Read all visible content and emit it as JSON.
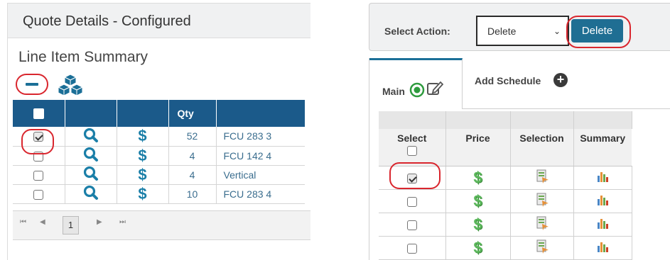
{
  "left": {
    "header_title": "Quote Details - Configured",
    "section_title": "Line Item Summary",
    "grid": {
      "headers": [
        "",
        "",
        "",
        "Qty",
        ""
      ],
      "rows": [
        {
          "checked": true,
          "qty": "52",
          "item": "FCU 283 3"
        },
        {
          "checked": false,
          "qty": "4",
          "item": "FCU 142 4"
        },
        {
          "checked": false,
          "qty": "4",
          "item": "Vertical"
        },
        {
          "checked": false,
          "qty": "10",
          "item": "FCU 283 4"
        }
      ]
    },
    "pager": {
      "first": "⏮",
      "prev": "◀",
      "page": "1",
      "next": "▶",
      "last": "⏭"
    }
  },
  "right": {
    "action_label": "Select Action:",
    "action_selected": "Delete",
    "delete_button": "Delete",
    "tabs": {
      "main": "Main",
      "add_schedule": "Add Schedule"
    },
    "grid": {
      "headers": [
        "Select",
        "Price",
        "Selection",
        "Summary"
      ],
      "rows": [
        {
          "checked": true
        },
        {
          "checked": false
        },
        {
          "checked": false
        },
        {
          "checked": false
        }
      ]
    }
  },
  "colors": {
    "header_blue": "#1b5a8a",
    "accent_blue": "#1b6f97",
    "highlight_red": "#d9262e",
    "price_green": "#5cb85c"
  }
}
